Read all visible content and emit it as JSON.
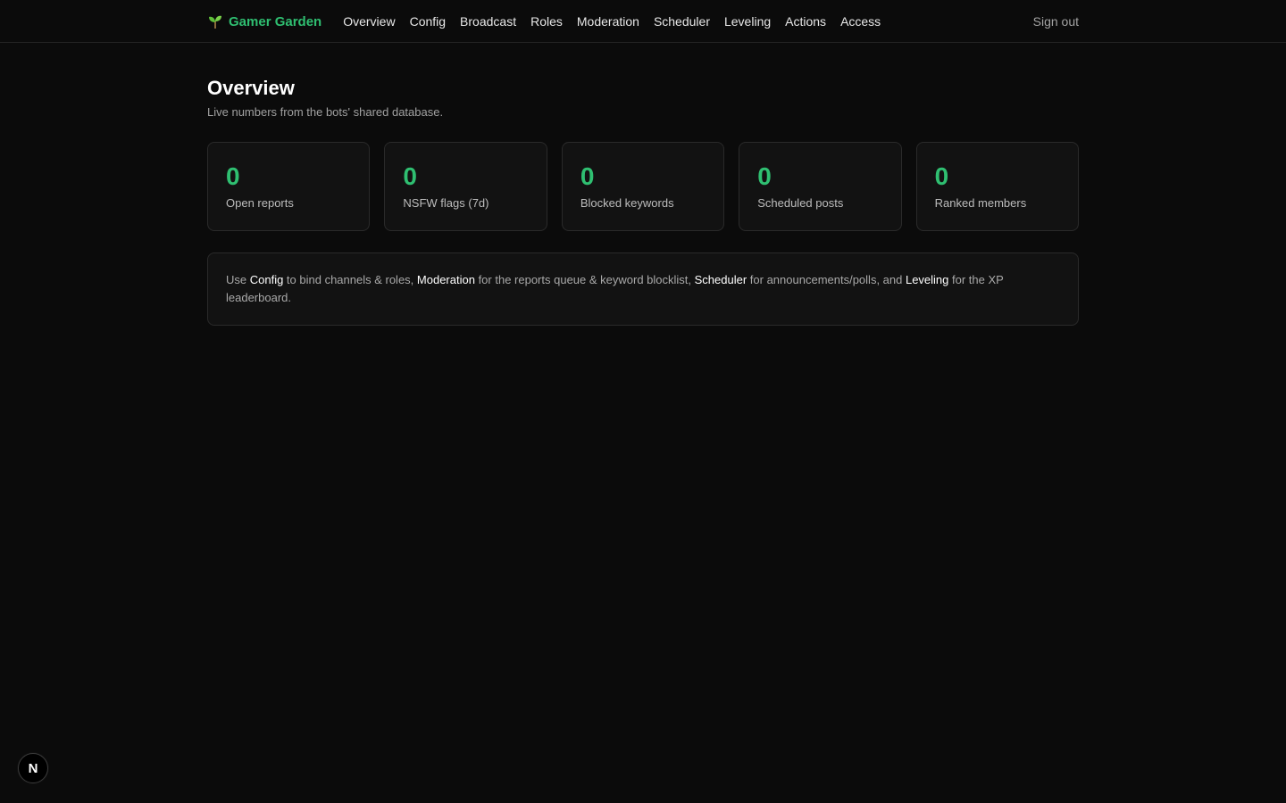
{
  "brand": {
    "name": "Gamer Garden",
    "icon": "sprout-icon",
    "color": "#2fbf71"
  },
  "nav": {
    "items": [
      {
        "label": "Overview"
      },
      {
        "label": "Config"
      },
      {
        "label": "Broadcast"
      },
      {
        "label": "Roles"
      },
      {
        "label": "Moderation"
      },
      {
        "label": "Scheduler"
      },
      {
        "label": "Leveling"
      },
      {
        "label": "Actions"
      },
      {
        "label": "Access"
      }
    ],
    "sign_out": "Sign out"
  },
  "page": {
    "title": "Overview",
    "subtitle": "Live numbers from the bots' shared database."
  },
  "stats": [
    {
      "value": "0",
      "label": "Open reports"
    },
    {
      "value": "0",
      "label": "NSFW flags (7d)"
    },
    {
      "value": "0",
      "label": "Blocked keywords"
    },
    {
      "value": "0",
      "label": "Scheduled posts"
    },
    {
      "value": "0",
      "label": "Ranked members"
    }
  ],
  "info": {
    "t1": "Use ",
    "k1": "Config",
    "t2": " to bind channels & roles, ",
    "k2": "Moderation",
    "t3": " for the reports queue & keyword blocklist, ",
    "k3": "Scheduler",
    "t4": " for announcements/polls, and ",
    "k4": "Leveling",
    "t5": " for the XP leaderboard."
  },
  "badge": {
    "letter": "N"
  },
  "colors": {
    "accent": "#2fbf71",
    "background": "#0b0b0b",
    "card": "#121212"
  }
}
